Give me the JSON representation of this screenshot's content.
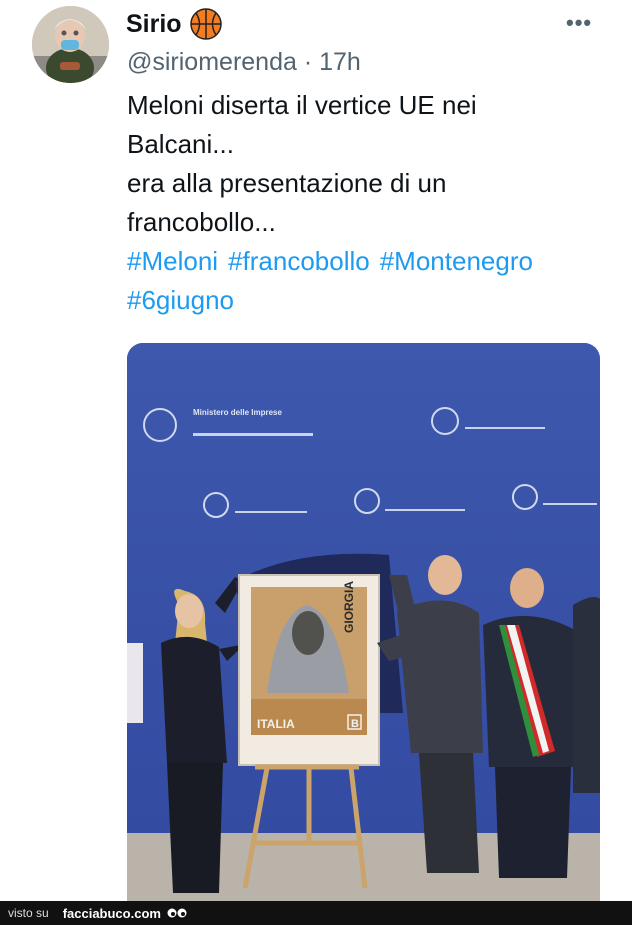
{
  "author": {
    "name": "Sirio",
    "handle": "@siriomerenda",
    "separator": "·",
    "time": "17h",
    "badge_icon": "basketball-icon"
  },
  "more_label": "•••",
  "tweet": {
    "lines": [
      "Meloni diserta il vertice UE nei",
      "Balcani...",
      "era alla presentazione di un",
      "francobollo..."
    ],
    "hashtags": [
      "#Meloni",
      "#francobollo",
      "#Montenegro",
      "#6giugno"
    ]
  },
  "photo": {
    "backdrop_text": "Ministero delle Imprese e del Made in Italy",
    "backdrop_text_short": "Ministero delle Imprese",
    "stamp_name": "GIORGIA",
    "stamp_country": "ITALIA",
    "stamp_value": "B"
  },
  "footer": {
    "prefix": "visto su",
    "site": "facciabuco.com"
  },
  "colors": {
    "link": "#1d9bf0",
    "muted": "#536471",
    "backdrop": "#3b55a6"
  }
}
